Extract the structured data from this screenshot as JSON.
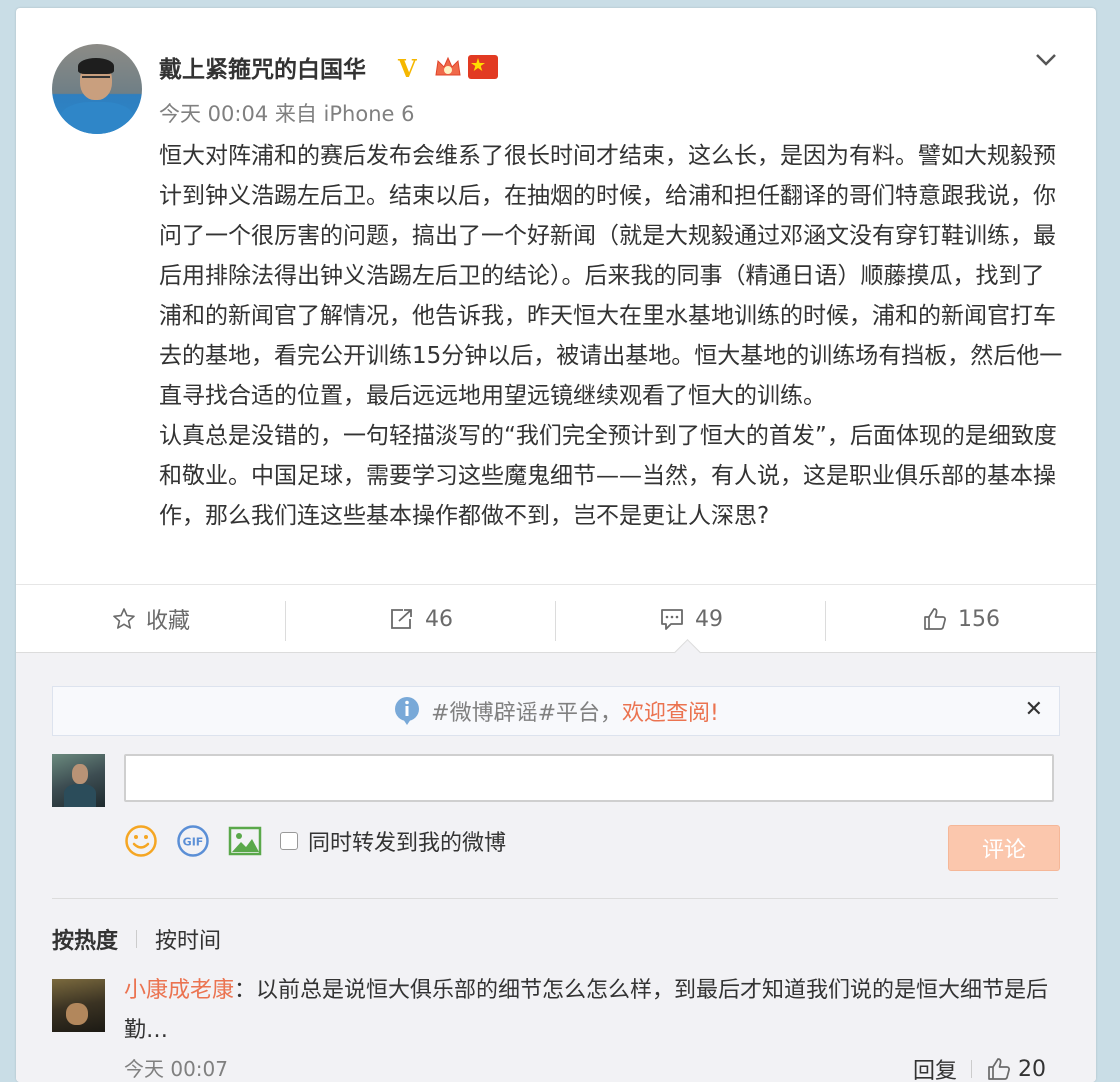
{
  "post": {
    "author": "戴上紧箍咒的白国华",
    "verified_badge": "V",
    "time_source": "今天 00:04 来自 iPhone 6",
    "paragraphs": [
      "恒大对阵浦和的赛后发布会维系了很长时间才结束，这么长，是因为有料。譬如大规毅预计到钟义浩踢左后卫。结束以后，在抽烟的时候，给浦和担任翻译的哥们特意跟我说，你问了一个很厉害的问题，搞出了一个好新闻（就是大规毅通过邓涵文没有穿钉鞋训练，最后用排除法得出钟义浩踢左后卫的结论）。后来我的同事（精通日语）顺藤摸瓜，找到了浦和的新闻官了解情况，他告诉我，昨天恒大在里水基地训练的时候，浦和的新闻官打车去的基地，看完公开训练15分钟以后，被请出基地。恒大基地的训练场有挡板，然后他一直寻找合适的位置，最后远远地用望远镜继续观看了恒大的训练。",
      "认真总是没错的，一句轻描淡写的“我们完全预计到了恒大的首发”，后面体现的是细致度和敬业。中国足球，需要学习这些魔鬼细节——当然，有人说，这是职业俱乐部的基本操作，那么我们连这些基本操作都做不到，岂不是更让人深思?"
    ],
    "icons": [
      "avatar",
      "vip-crown-icon",
      "china-flag-icon",
      "chevron-down-icon"
    ]
  },
  "actions": {
    "favorite": "收藏",
    "repost": "46",
    "comment": "49",
    "like": "156"
  },
  "notice": {
    "text": "#微博辟谣#平台，",
    "link": "欢迎查阅!",
    "close": "✕"
  },
  "composer": {
    "input_value": "",
    "repost_checkbox_label": "同时转发到我的微博",
    "submit_label": "评论",
    "tools": [
      "emoji-icon",
      "gif-icon",
      "image-icon"
    ]
  },
  "sort": {
    "active": "按热度",
    "other": "按时间"
  },
  "comments": [
    {
      "user": "小康成老康",
      "separator": "：",
      "text": "以前总是说恒大俱乐部的细节怎么怎么样，到最后才知道我们说的是恒大细节是后勤…",
      "time": "今天 00:07",
      "reply_label": "回复",
      "likes": "20"
    }
  ],
  "colors": {
    "accent": "#eb7350",
    "background": "#c9dde6",
    "submit_disabled": "#fbc7ad"
  }
}
